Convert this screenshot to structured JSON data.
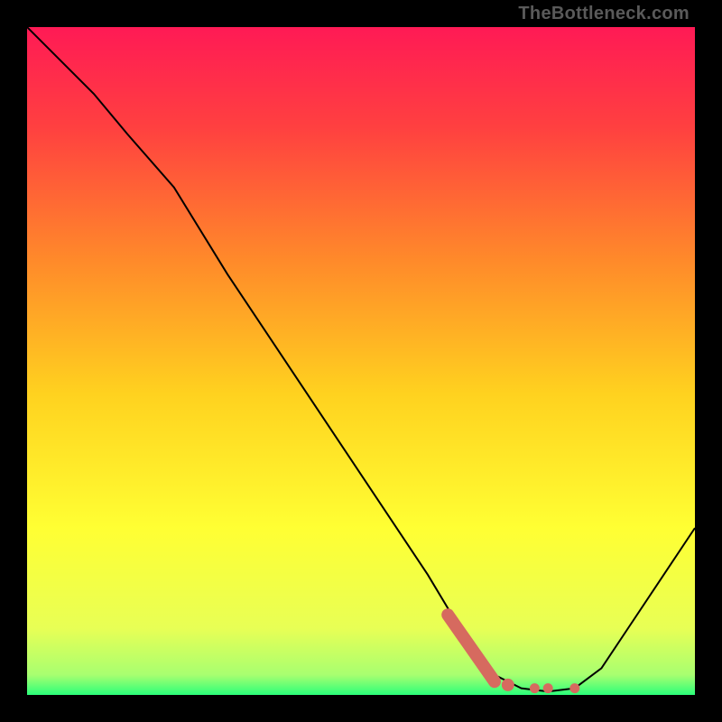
{
  "watermark": {
    "text": "TheBottleneck.com"
  },
  "colors": {
    "highlight": "#d66a5f",
    "frame_bg": "#000000",
    "curve": "#000000",
    "gradient_stops": [
      {
        "pct": 0,
        "color": "#ff1a55"
      },
      {
        "pct": 15,
        "color": "#ff4040"
      },
      {
        "pct": 35,
        "color": "#ff8a2a"
      },
      {
        "pct": 55,
        "color": "#ffd21f"
      },
      {
        "pct": 75,
        "color": "#ffff33"
      },
      {
        "pct": 90,
        "color": "#e8ff55"
      },
      {
        "pct": 97,
        "color": "#a8ff70"
      },
      {
        "pct": 100,
        "color": "#2bff7a"
      }
    ]
  },
  "chart_data": {
    "type": "line",
    "title": "",
    "xlabel": "",
    "ylabel": "",
    "xlim": [
      0,
      100
    ],
    "ylim": [
      0,
      100
    ],
    "series": [
      {
        "name": "bottleneck-curve",
        "x": [
          0,
          10,
          15,
          22,
          30,
          40,
          50,
          60,
          66,
          70,
          74,
          78,
          82,
          86,
          90,
          100
        ],
        "y": [
          100,
          90,
          84,
          76,
          63,
          48,
          33,
          18,
          8,
          3,
          1,
          0.5,
          1,
          4,
          10,
          25
        ]
      }
    ],
    "highlight": {
      "name": "optimal-range",
      "segment": {
        "x": [
          63,
          70
        ],
        "y": [
          12,
          2
        ]
      },
      "dots": {
        "x": [
          72,
          76,
          78,
          82
        ],
        "y": [
          1.5,
          1,
          1,
          1
        ]
      }
    }
  }
}
